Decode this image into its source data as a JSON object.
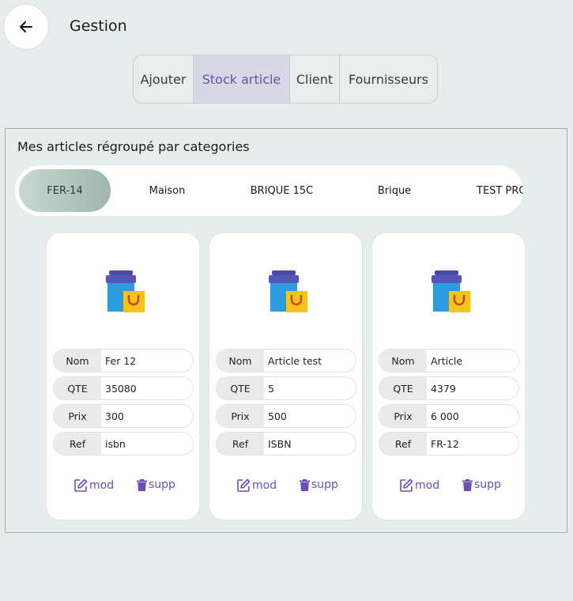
{
  "header": {
    "title": "Gestion",
    "back_icon": "arrow-left-icon"
  },
  "tabs": [
    {
      "label": "Ajouter",
      "active": false
    },
    {
      "label": "Stock article",
      "active": true
    },
    {
      "label": "Client",
      "active": false
    },
    {
      "label": "Fournisseurs",
      "active": false
    }
  ],
  "panel": {
    "title": "Mes articles régroupé par categories"
  },
  "categories": [
    {
      "label": "FER-14",
      "active": true
    },
    {
      "label": "Maison",
      "active": false
    },
    {
      "label": "BRIQUE 15C",
      "active": false
    },
    {
      "label": "Brique",
      "active": false
    },
    {
      "label": "TEST PRO",
      "active": false
    }
  ],
  "field_labels": {
    "nom": "Nom",
    "qte": "QTE",
    "prix": "Prix",
    "ref": "Ref"
  },
  "actions": {
    "edit": "mod",
    "delete": "supp"
  },
  "articles": [
    {
      "nom": "Fer 12",
      "qte": "35080",
      "prix": "300",
      "ref": "isbn"
    },
    {
      "nom": "Article test",
      "qte": "5",
      "prix": "500",
      "ref": "ISBN"
    },
    {
      "nom": "Article",
      "qte": "4379",
      "prix": "6 000",
      "ref": "FR-12"
    }
  ],
  "colors": {
    "accent": "#6b4fb5",
    "active_tab_bg": "#d8d8e4",
    "background": "#e7edec"
  }
}
